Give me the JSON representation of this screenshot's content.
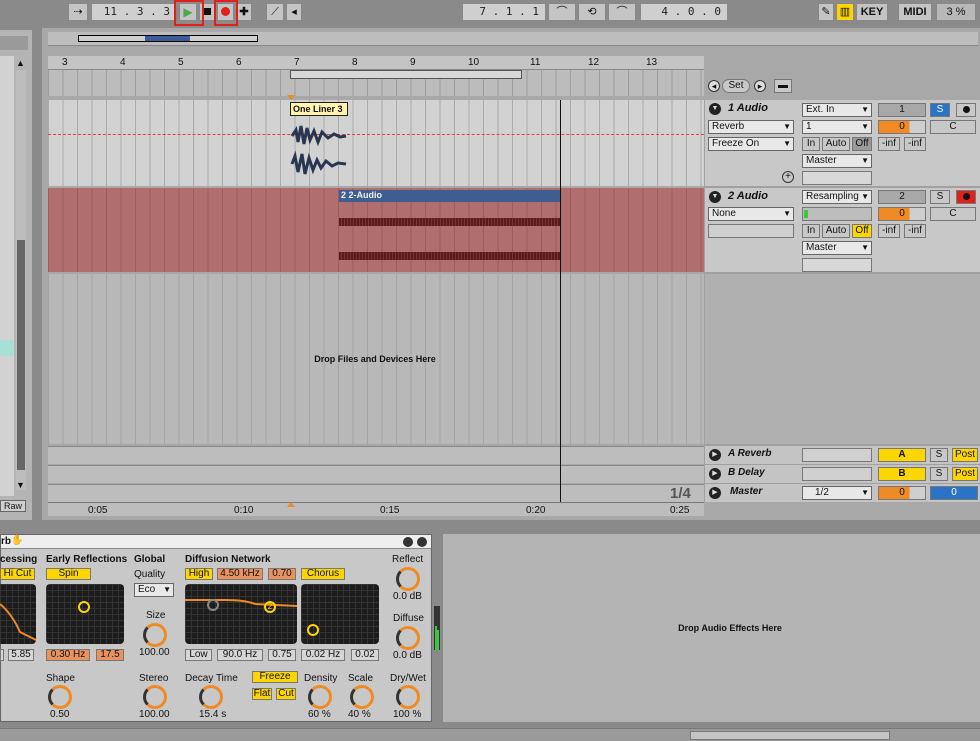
{
  "transport": {
    "arrangement_position": "11 .  3 .  3",
    "loop_start": "7 .  1 .  1",
    "loop_length": "4 .  0 .  0",
    "key_label": "KEY",
    "midi_label": "MIDI",
    "cpu": "3 %"
  },
  "annotations": [
    "1",
    "2",
    "3",
    "4"
  ],
  "ruler": {
    "bars": [
      "3",
      "4",
      "5",
      "6",
      "7",
      "8",
      "9",
      "10",
      "11",
      "12",
      "13"
    ],
    "times": [
      "0:05",
      "0:10",
      "0:15",
      "0:20",
      "0:25"
    ]
  },
  "session": {
    "set_label": "Set"
  },
  "tracks": [
    {
      "name": "1 Audio",
      "clip": "One Liner 3",
      "device": "Reverb",
      "param": "Freeze On",
      "input_type": "Ext. In",
      "input_channel": "1",
      "monitor": [
        "In",
        "Auto",
        "Off"
      ],
      "output": "Master",
      "number": "1",
      "volume": "0",
      "pan": "C",
      "solo": "S",
      "peak_l": "-inf",
      "peak_r": "-inf"
    },
    {
      "name": "2 Audio",
      "clip": "2 2-Audio",
      "device": "None",
      "input_type": "Resampling",
      "monitor": [
        "In",
        "Auto",
        "Off"
      ],
      "output": "Master",
      "number": "2",
      "volume": "0",
      "pan": "C",
      "solo": "S",
      "peak_l": "-inf",
      "peak_r": "-inf"
    }
  ],
  "drop_zone": "Drop Files and Devices Here",
  "returns": [
    {
      "name": "A Reverb",
      "letter": "A",
      "solo": "S",
      "post": "Post"
    },
    {
      "name": "B Delay",
      "letter": "B",
      "solo": "S",
      "post": "Post"
    }
  ],
  "master": {
    "name": "Master",
    "output": "1/2",
    "volume": "0",
    "pan": "0",
    "zoom": "1/4"
  },
  "left_panel": {
    "raw": "Raw"
  },
  "device": {
    "title": "rb",
    "sections": {
      "processing": "cessing",
      "early_reflections": "Early Reflections",
      "global": "Global",
      "diffusion": "Diffusion Network",
      "reflect": "Reflect",
      "diffuse": "Diffuse"
    },
    "hi_cut": "Hi Cut",
    "spin": "Spin",
    "quality_label": "Quality",
    "quality_value": "Eco",
    "high": "High",
    "high_freq": "4.50 kHz",
    "high_q": "0.70",
    "chorus": "Chorus",
    "size_label": "Size",
    "size_value": "100.00",
    "reflect_value": "0.0 dB",
    "diffuse_value": "0.0 dB",
    "proc_val": "5.85",
    "er_freq": "0.30 Hz",
    "er_amt": "17.5",
    "low": "Low",
    "low_freq": "90.0 Hz",
    "low_q": "0.75",
    "chorus_rate": "0.02 Hz",
    "chorus_amt": "0.02",
    "shape_label": "Shape",
    "shape_value": "0.50",
    "stereo_label": "Stereo",
    "stereo_value": "100.00",
    "decay_label": "Decay Time",
    "decay_value": "15.4 s",
    "freeze": "Freeze",
    "flat": "Flat",
    "cut": "Cut",
    "density_label": "Density",
    "density_value": "60 %",
    "scale_label": "Scale",
    "scale_value": "40 %",
    "drywet_label": "Dry/Wet",
    "drywet_value": "100 %"
  },
  "effects_drop": "Drop Audio Effects Here"
}
